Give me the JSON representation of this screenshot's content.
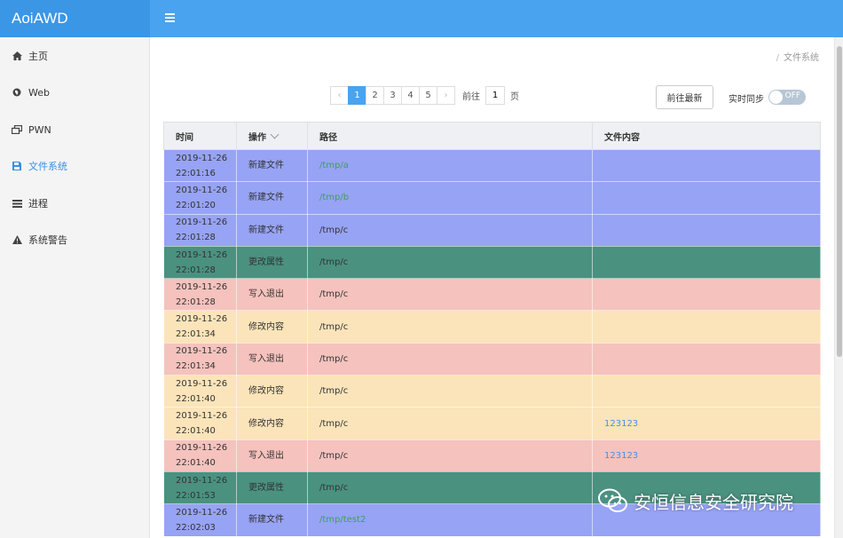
{
  "app": {
    "brand": "AoiAWD"
  },
  "sidebar": {
    "items": [
      {
        "label": "主页",
        "icon": "home-icon",
        "active": false
      },
      {
        "label": "Web",
        "icon": "globe-icon",
        "active": false
      },
      {
        "label": "PWN",
        "icon": "window-restore-icon",
        "active": false
      },
      {
        "label": "文件系统",
        "icon": "save-icon",
        "active": true
      },
      {
        "label": "进程",
        "icon": "list-icon",
        "active": false
      },
      {
        "label": "系统警告",
        "icon": "warning-icon",
        "active": false
      }
    ]
  },
  "breadcrumb": {
    "separator": "/",
    "current": "文件系统"
  },
  "pagination": {
    "prev": "‹",
    "next": "›",
    "pages": [
      "1",
      "2",
      "3",
      "4",
      "5"
    ],
    "current_page": "1",
    "goto_label": "前往",
    "goto_value": "1",
    "page_suffix": "页"
  },
  "toolbar": {
    "latest_button": "前往最新",
    "sync_label": "实时同步",
    "sync_toggle": "OFF"
  },
  "table": {
    "headers": {
      "time": "时间",
      "operation": "操作",
      "path": "路径",
      "content": "文件内容"
    },
    "rows": [
      {
        "date": "2019-11-26",
        "time": "22:01:16",
        "operation": "新建文件",
        "path": "/tmp/a",
        "content": "",
        "bg": "#97a3f4",
        "path_color": "green"
      },
      {
        "date": "2019-11-26",
        "time": "22:01:20",
        "operation": "新建文件",
        "path": "/tmp/b",
        "content": "",
        "bg": "#97a3f4",
        "path_color": "green"
      },
      {
        "date": "2019-11-26",
        "time": "22:01:28",
        "operation": "新建文件",
        "path": "/tmp/c",
        "content": "",
        "bg": "#97a3f4",
        "path_color": "dark"
      },
      {
        "date": "2019-11-26",
        "time": "22:01:28",
        "operation": "更改属性",
        "path": "/tmp/c",
        "content": "",
        "bg": "#4a9180",
        "path_color": "dark"
      },
      {
        "date": "2019-11-26",
        "time": "22:01:28",
        "operation": "写入退出",
        "path": "/tmp/c",
        "content": "",
        "bg": "#f5c2bd",
        "path_color": "dark"
      },
      {
        "date": "2019-11-26",
        "time": "22:01:34",
        "operation": "修改内容",
        "path": "/tmp/c",
        "content": "",
        "bg": "#fbe4b9",
        "path_color": "dark"
      },
      {
        "date": "2019-11-26",
        "time": "22:01:34",
        "operation": "写入退出",
        "path": "/tmp/c",
        "content": "",
        "bg": "#f5c2bd",
        "path_color": "dark"
      },
      {
        "date": "2019-11-26",
        "time": "22:01:40",
        "operation": "修改内容",
        "path": "/tmp/c",
        "content": "",
        "bg": "#fbe4b9",
        "path_color": "dark"
      },
      {
        "date": "2019-11-26",
        "time": "22:01:40",
        "operation": "修改内容",
        "path": "/tmp/c",
        "content": "123123",
        "bg": "#fbe4b9",
        "path_color": "dark"
      },
      {
        "date": "2019-11-26",
        "time": "22:01:40",
        "operation": "写入退出",
        "path": "/tmp/c",
        "content": "123123",
        "bg": "#f5c2bd",
        "path_color": "dark"
      },
      {
        "date": "2019-11-26",
        "time": "22:01:53",
        "operation": "更改属性",
        "path": "/tmp/c",
        "content": "",
        "bg": "#4a9180",
        "path_color": "dark"
      },
      {
        "date": "2019-11-26",
        "time": "22:02:03",
        "operation": "新建文件",
        "path": "/tmp/test2",
        "content": "",
        "bg": "#97a3f4",
        "path_color": "green"
      }
    ]
  },
  "watermark": {
    "text": "安恒信息安全研究院",
    "icon": "wechat-icon"
  },
  "colors": {
    "topbar": "#4aa3ee",
    "active_nav": "#3a8ee6",
    "create": "#97a3f4",
    "attrib": "#4a9180",
    "close_write": "#f5c2bd",
    "modify": "#fbe4b9"
  }
}
